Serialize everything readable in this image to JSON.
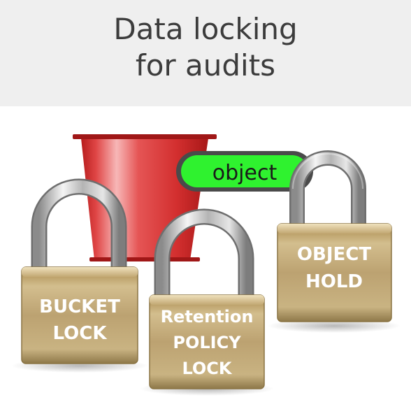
{
  "header": {
    "title_line1": "Data locking",
    "title_line2": "for audits"
  },
  "bucket": {
    "color": "#e03636"
  },
  "object_pill": {
    "label": "object",
    "color": "#2ff22f"
  },
  "locks": {
    "bucket_lock": {
      "line1": "BUCKET",
      "line2": "LOCK"
    },
    "retention_lock": {
      "line1": "Retention",
      "line2": "POLICY",
      "line3": "LOCK"
    },
    "object_hold": {
      "line1": "OBJECT",
      "line2": "HOLD"
    },
    "body_color": "#c4ad7c"
  }
}
